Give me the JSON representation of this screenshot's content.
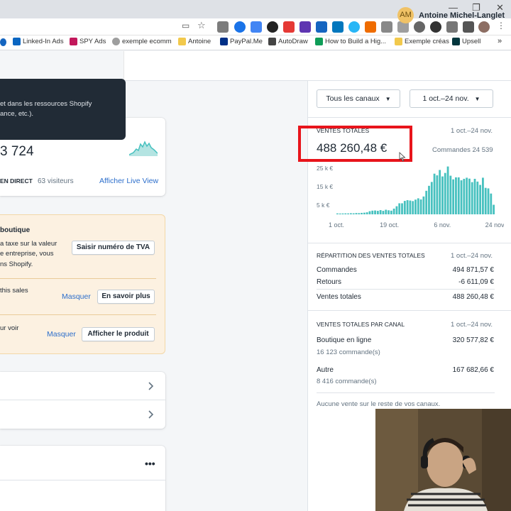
{
  "browser": {
    "window_controls": [
      "—",
      "❐",
      "✕"
    ],
    "toolbar_icons": [
      {
        "name": "cast-icon",
        "glyph": "▭"
      },
      {
        "name": "bookmark-star-icon",
        "glyph": "☆"
      }
    ],
    "bookmarks": [
      {
        "label": "Linked-In Ads",
        "icon": "linkedin-icon",
        "color": "#0a66c2"
      },
      {
        "label": "SPY Ads",
        "icon": "spy-icon",
        "color": "#c2185b"
      },
      {
        "label": "exemple ecomm",
        "icon": "cloud-icon",
        "color": "#9e9e9e"
      },
      {
        "label": "Antoine",
        "icon": "folder-icon",
        "color": "#f2c94c"
      },
      {
        "label": "PayPal.Me",
        "icon": "paypal-icon",
        "color": "#003087"
      },
      {
        "label": "AutoDraw",
        "icon": "autodraw-icon",
        "color": "#444444"
      },
      {
        "label": "How to Build a Hig...",
        "icon": "sheets-icon",
        "color": "#0f9d58"
      },
      {
        "label": "Exemple créas",
        "icon": "folder-icon",
        "color": "#f2c94c"
      },
      {
        "label": "Upsell",
        "icon": "zendesk-icon",
        "color": "#03363d"
      }
    ],
    "more_bookmarks": "»"
  },
  "topbar": {
    "avatar_initials": "AM",
    "user_name": "Antoine Michel-Langlet"
  },
  "tooltip": {
    "line1": "et dans les ressources Shopify",
    "line2": "ance, etc.)."
  },
  "sessions_card": {
    "value": "3 724",
    "live_badge": "EN DIRECT",
    "visitors": "63 visiteurs",
    "live_link": "Afficher Live View"
  },
  "notice_card": {
    "title": "boutique",
    "vat_text": [
      "a taxe sur la valeur",
      "e entreprise, vous",
      "ns Shopify."
    ],
    "vat_button": "Saisir numéro de TVA",
    "sales_text": "this sales",
    "hide_label_1": "Masquer",
    "learn_more_button": "En savoir plus",
    "product_text": "ur voir",
    "hide_label_2": "Masquer",
    "show_product_button": "Afficher le produit"
  },
  "more_actions": "•••",
  "filters": {
    "channel_select": "Tous les canaux",
    "date_select": "1 oct.–24 nov."
  },
  "total_sales": {
    "label": "VENTES TOTALES",
    "date_range": "1 oct.–24 nov.",
    "amount": "488 260,48 €",
    "orders_label": "Commandes 24 539"
  },
  "chart_data": {
    "type": "bar",
    "title": "",
    "xlabel": "",
    "ylabel": "",
    "y_tick_labels": [
      "25 k €",
      "15 k €",
      "5 k €"
    ],
    "y_tick_values": [
      25000,
      15000,
      5000
    ],
    "x_tick_labels": [
      "1 oct.",
      "19 oct.",
      "6 nov.",
      "24 nov."
    ],
    "ylim": [
      0,
      27000
    ],
    "color": "#47c1bf",
    "values": [
      500,
      450,
      480,
      520,
      500,
      600,
      550,
      700,
      650,
      800,
      900,
      1100,
      1700,
      2000,
      2100,
      1900,
      2300,
      1900,
      2500,
      2200,
      2000,
      3100,
      4400,
      6000,
      6000,
      7300,
      7700,
      7500,
      7200,
      8000,
      8700,
      8100,
      9700,
      12800,
      15500,
      17600,
      22100,
      21200,
      24100,
      20600,
      22500,
      26000,
      21000,
      19000,
      20100,
      20100,
      18500,
      19300,
      19900,
      19400,
      17500,
      19300,
      17800,
      16000,
      19900,
      14400,
      14100,
      11300,
      5200
    ]
  },
  "breakdown": {
    "label": "RÉPARTITION DES VENTES TOTALES",
    "date_range": "1 oct.–24 nov.",
    "rows": [
      {
        "label": "Commandes",
        "value": "494 871,57 €"
      },
      {
        "label": "Retours",
        "value": "-6 611,09 €"
      },
      {
        "label": "Ventes totales",
        "value": "488 260,48 €"
      }
    ]
  },
  "by_channel": {
    "label": "VENTES TOTALES PAR CANAL",
    "date_range": "1 oct.–24 nov.",
    "channels": [
      {
        "name": "Boutique en ligne",
        "value": "320 577,82 €",
        "orders": "16 123 commande(s)"
      },
      {
        "name": "Autre",
        "value": "167 682,66 €",
        "orders": "8 416 commande(s)"
      }
    ],
    "footer_note": "Aucune vente sur le reste de vos canaux."
  }
}
